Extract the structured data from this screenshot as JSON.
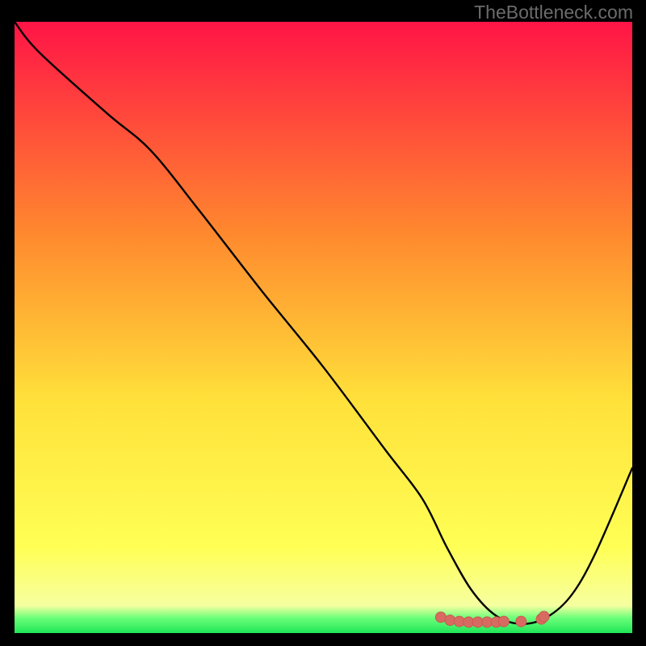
{
  "watermark": {
    "text": "TheBottleneck.com"
  },
  "colors": {
    "bg": "#000000",
    "curve": "#000000",
    "marker_fill": "#d86b61",
    "marker_stroke": "#c85a50",
    "grad_top": "#ff1446",
    "grad_mid1": "#ff8a2e",
    "grad_mid2": "#ffe13a",
    "grad_yellow": "#ffff55",
    "grad_green": "#1ee657"
  },
  "chart_data": {
    "type": "line",
    "title": "",
    "xlabel": "",
    "ylabel": "",
    "xlim": [
      0,
      100
    ],
    "ylim": [
      0,
      100
    ],
    "x": [
      0,
      4,
      15,
      22,
      30,
      40,
      50,
      60,
      66,
      70,
      74,
      78,
      82,
      86,
      90,
      94,
      100
    ],
    "bottleneck": [
      100,
      95,
      85,
      79,
      69,
      56,
      43.5,
      30,
      22,
      14,
      7,
      2.8,
      1.5,
      2.5,
      6,
      13,
      27
    ],
    "optimal_band": {
      "x_start": 69,
      "x_end": 85.7,
      "y": 1.9
    },
    "markers": [
      {
        "x": 69.0,
        "y": 2.6
      },
      {
        "x": 70.5,
        "y": 2.1
      },
      {
        "x": 72.0,
        "y": 1.9
      },
      {
        "x": 73.5,
        "y": 1.8
      },
      {
        "x": 75.0,
        "y": 1.8
      },
      {
        "x": 76.5,
        "y": 1.8
      },
      {
        "x": 78.0,
        "y": 1.8
      },
      {
        "x": 79.2,
        "y": 1.9
      },
      {
        "x": 82.0,
        "y": 1.9
      },
      {
        "x": 85.3,
        "y": 2.3
      },
      {
        "x": 85.7,
        "y": 2.7
      }
    ]
  }
}
